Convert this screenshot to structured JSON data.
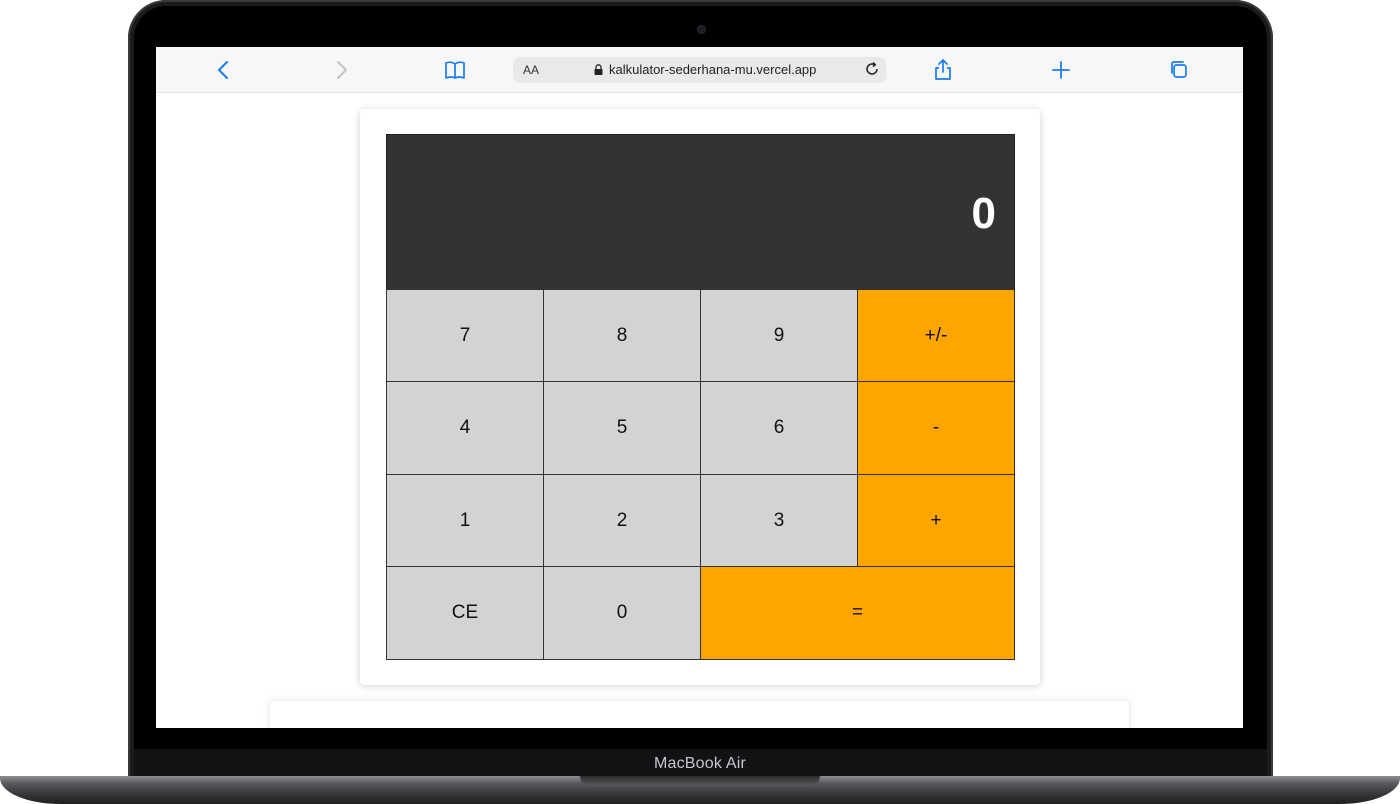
{
  "browser": {
    "text_size_label": "AA",
    "url": "kalkulator-sederhana-mu.vercel.app",
    "accent_color": "#1a7cf2",
    "icons": [
      "back-icon",
      "forward-icon",
      "bookmarks-icon",
      "lock-icon",
      "reload-icon",
      "share-icon",
      "new-tab-icon",
      "tabs-icon"
    ]
  },
  "calculator": {
    "display": "0",
    "display_color": "#333333",
    "key_color": "#d3d3d3",
    "operator_color": "#ffa500",
    "keys": {
      "k7": "7",
      "k8": "8",
      "k9": "9",
      "plus_minus": "+/-",
      "k4": "4",
      "k5": "5",
      "k6": "6",
      "minus": "-",
      "k1": "1",
      "k2": "2",
      "k3": "3",
      "plus": "+",
      "ce": "CE",
      "k0": "0",
      "equals": "="
    }
  },
  "device": {
    "label": "MacBook Air"
  }
}
